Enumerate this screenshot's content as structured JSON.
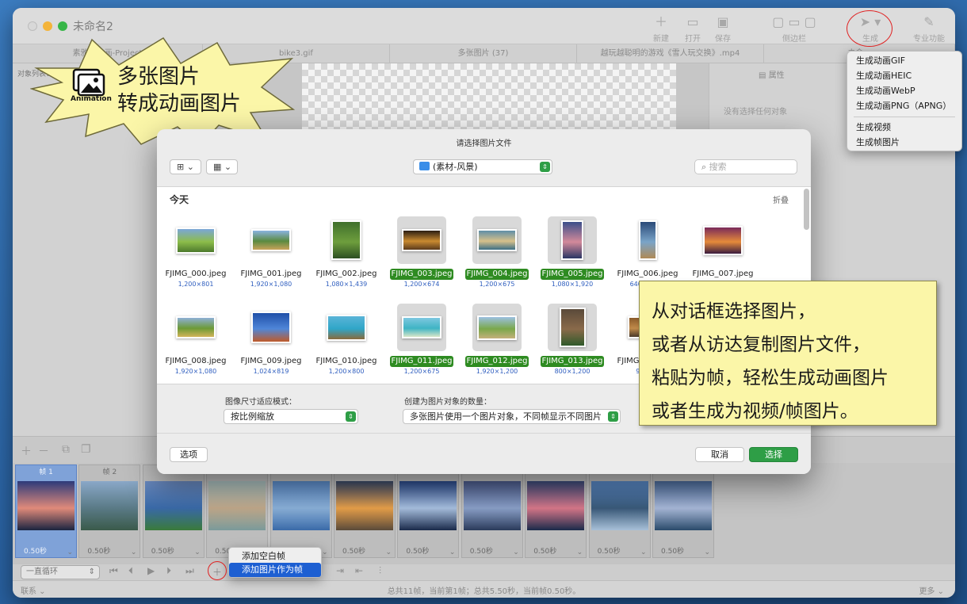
{
  "window": {
    "title": "未命名2"
  },
  "toolbar": {
    "new": "新建",
    "open": "打开",
    "save": "保存",
    "sidebar": "侧边栏",
    "generate": "生成",
    "pro": "专业功能"
  },
  "tabs": [
    "素雅的动画-Project",
    "bike3.gif",
    "多张图片 (37)",
    "越玩越聪明的游戏《雪人玩交换》.mp4",
    "未命..."
  ],
  "left_pane": {
    "object_list_label": "对象列表："
  },
  "right_pane": {
    "properties_label": "属性",
    "no_selection": "没有选择任何对象"
  },
  "generate_menu": {
    "items": [
      "生成动画GIF",
      "生成动画HEIC",
      "生成动画WebP",
      "生成动画PNG（APNG）",
      "生成视频",
      "生成帧图片"
    ]
  },
  "promo_burst": {
    "line1": "多张图片",
    "line2": "转成动画图片",
    "badge": "Animation"
  },
  "dialog": {
    "title": "请选择图片文件",
    "path": "(素材-风景)",
    "search_placeholder": "搜索",
    "section": "今天",
    "collapse": "折叠",
    "files": [
      {
        "name": "FJIMG_000.jpeg",
        "dim": "1,200×801",
        "selected": false,
        "colors": [
          "#7aa6d8",
          "#8dbd4a",
          "#4d7a2d"
        ]
      },
      {
        "name": "FJIMG_001.jpeg",
        "dim": "1,920×1,080",
        "selected": false,
        "colors": [
          "#8ab3e0",
          "#5a8a40",
          "#c9a35a"
        ]
      },
      {
        "name": "FJIMG_002.jpeg",
        "dim": "1,080×1,439",
        "selected": false,
        "colors": [
          "#3f6f2c",
          "#6e9e3d",
          "#2c4f21"
        ]
      },
      {
        "name": "FJIMG_003.jpeg",
        "dim": "1,200×674",
        "selected": true,
        "colors": [
          "#2b1d12",
          "#c98a30",
          "#5a3a1c"
        ]
      },
      {
        "name": "FJIMG_004.jpeg",
        "dim": "1,200×675",
        "selected": true,
        "colors": [
          "#5f8fa8",
          "#d6c08a",
          "#3c6f86"
        ]
      },
      {
        "name": "FJIMG_005.jpeg",
        "dim": "1,080×1,920",
        "selected": true,
        "colors": [
          "#3b4f8a",
          "#d38a9a",
          "#2a3564"
        ]
      },
      {
        "name": "FJIMG_006.jpeg",
        "dim": "640×1,385",
        "selected": false,
        "colors": [
          "#2a4a78",
          "#7aa4c8",
          "#b08a56"
        ]
      },
      {
        "name": "FJIMG_007.jpeg",
        "dim": "1,023×767",
        "selected": false,
        "colors": [
          "#7a2a5a",
          "#e58a3a",
          "#3a1c3f"
        ]
      },
      {
        "name": "FJIMG_008.jpeg",
        "dim": "1,920×1,080",
        "selected": false,
        "colors": [
          "#8fb0d6",
          "#6c9a36",
          "#d2b45a"
        ]
      },
      {
        "name": "FJIMG_009.jpeg",
        "dim": "1,024×819",
        "selected": false,
        "colors": [
          "#1f4fa8",
          "#4f86d8",
          "#c05a2a"
        ]
      },
      {
        "name": "FJIMG_010.jpeg",
        "dim": "1,200×800",
        "selected": false,
        "colors": [
          "#5ab4d8",
          "#2fa6c8",
          "#8a6a3a"
        ]
      },
      {
        "name": "FJIMG_011.jpeg",
        "dim": "1,200×675",
        "selected": true,
        "colors": [
          "#7ec8e0",
          "#3fb4c4",
          "#d8e6c8"
        ]
      },
      {
        "name": "FJIMG_012.jpeg",
        "dim": "1,920×1,200",
        "selected": true,
        "colors": [
          "#9cc0e0",
          "#7aa84a",
          "#c4b07a"
        ]
      },
      {
        "name": "FJIMG_013.jpeg",
        "dim": "800×1,200",
        "selected": true,
        "colors": [
          "#5a4a3a",
          "#8a6a4a",
          "#2f5a2a"
        ]
      },
      {
        "name": "FJIMG_014.jpeg",
        "dim": "900×...",
        "selected": false,
        "colors": [
          "#8a5a2a",
          "#c08a4a",
          "#4a3a2a"
        ]
      }
    ],
    "resize_mode_label": "图像尺寸适应模式：",
    "resize_mode_value": "按比例缩放",
    "object_count_label": "创建为图片对象的数量：",
    "object_count_value": "多张图片使用一个图片对象，不同帧显示不同图片",
    "options_button": "选项",
    "cancel_button": "取消",
    "choose_button": "选择"
  },
  "callout": {
    "lines": [
      "从对话框选择图片，",
      "或者从访达复制图片文件，",
      "粘贴为帧，轻松生成动画图片",
      "或者生成为视频/帧图片。"
    ]
  },
  "frames": [
    {
      "label": "帧 1",
      "duration": "0.50秒",
      "colors": [
        "#2c3a7a",
        "#e08a7a",
        "#1a2440"
      ]
    },
    {
      "label": "帧 2",
      "duration": "0.50秒",
      "colors": [
        "#8aa8c8",
        "#5a7a86",
        "#3a5a4a"
      ]
    },
    {
      "label": "",
      "duration": "0.50秒",
      "colors": [
        "#6a8ac0",
        "#3a6aa8",
        "#3a7a3a"
      ]
    },
    {
      "label": "",
      "duration": "0.50秒",
      "colors": [
        "#a8c0c0",
        "#c0a88a",
        "#7a9a9a"
      ]
    },
    {
      "label": "",
      "duration": "0.50秒",
      "colors": [
        "#5a8ac8",
        "#8ab0d8",
        "#3a6aa8"
      ]
    },
    {
      "label": "",
      "duration": "0.50秒",
      "colors": [
        "#3a4a6a",
        "#e8a04a",
        "#5a4a3a"
      ]
    },
    {
      "label": "",
      "duration": "0.50秒",
      "colors": [
        "#2a4a8a",
        "#a8c0e0",
        "#1a2a4a"
      ]
    },
    {
      "label": "",
      "duration": "0.50秒",
      "colors": [
        "#4a5a8a",
        "#8aa0c8",
        "#2a3a5a"
      ]
    },
    {
      "label": "",
      "duration": "0.50秒",
      "colors": [
        "#3a4a7a",
        "#d8788a",
        "#1a2a4a"
      ]
    },
    {
      "label": "",
      "duration": "0.50秒",
      "colors": [
        "#5a8ac8",
        "#3a5a7a",
        "#a8c0d8"
      ]
    },
    {
      "label": "",
      "duration": "0.50秒",
      "colors": [
        "#4a6a9a",
        "#a8b8d8",
        "#2a4a6a"
      ]
    }
  ],
  "add_menu": {
    "items": [
      "添加空白帧",
      "添加图片作为帧"
    ]
  },
  "playbar": {
    "loop": "一直循环"
  },
  "statusbar": {
    "left": "联系",
    "center": "总共11帧，当前第1帧；总共5.50秒，当前帧0.50秒。",
    "right": "更多"
  },
  "colors": {
    "accent_green": "#2e9e46",
    "selection_blue": "#1d5fd2",
    "highlight_circle": "#e02020",
    "callout_bg": "#fbf6a8"
  }
}
